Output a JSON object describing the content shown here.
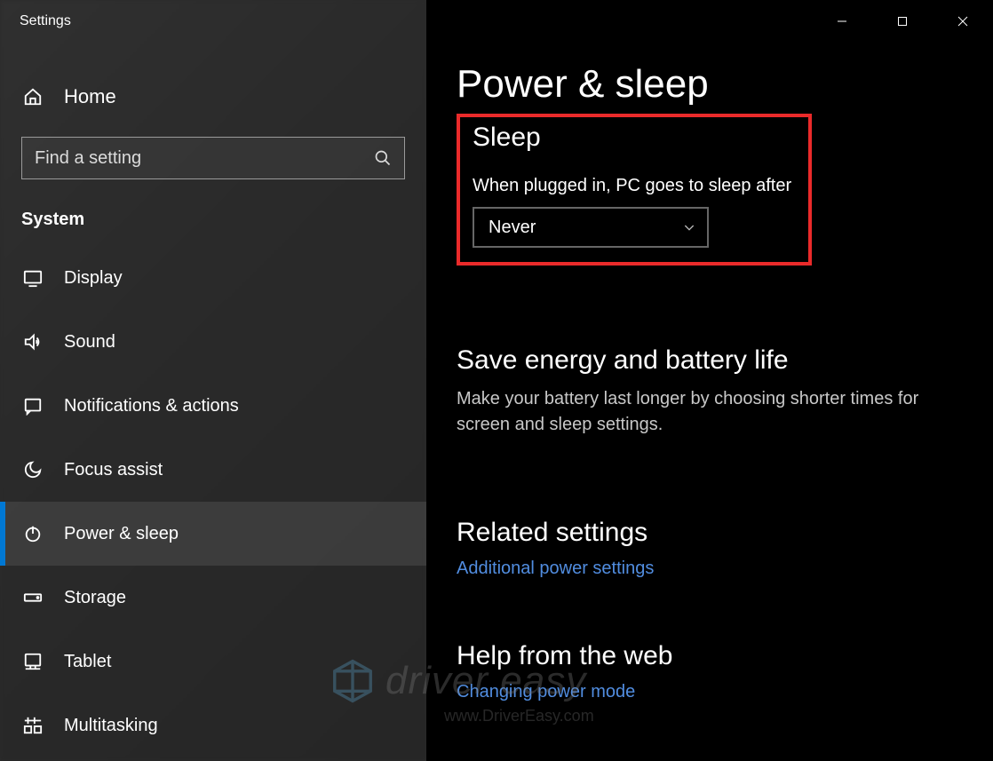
{
  "titlebar": {
    "title": "Settings"
  },
  "window": {
    "min": "minimize",
    "max": "maximize",
    "close": "close"
  },
  "home": {
    "label": "Home"
  },
  "search": {
    "placeholder": "Find a setting"
  },
  "sidebar": {
    "section": "System",
    "items": [
      {
        "label": "Display"
      },
      {
        "label": "Sound"
      },
      {
        "label": "Notifications & actions"
      },
      {
        "label": "Focus assist"
      },
      {
        "label": "Power & sleep"
      },
      {
        "label": "Storage"
      },
      {
        "label": "Tablet"
      },
      {
        "label": "Multitasking"
      }
    ]
  },
  "main": {
    "title": "Power & sleep",
    "sleep": {
      "head": "Sleep",
      "label": "When plugged in, PC goes to sleep after",
      "value": "Never"
    },
    "tip": {
      "head": "Save energy and battery life",
      "text": "Make your battery last longer by choosing shorter times for screen and sleep settings."
    },
    "related": {
      "head": "Related settings",
      "link": "Additional power settings"
    },
    "help": {
      "head": "Help from the web",
      "link": "Changing power mode"
    }
  },
  "watermark": {
    "text": "driver easy",
    "sub": "www.DriverEasy.com"
  }
}
